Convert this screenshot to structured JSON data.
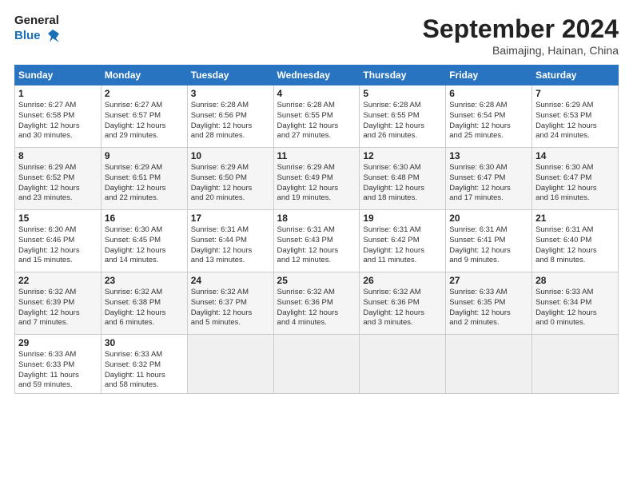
{
  "header": {
    "logo_line1": "General",
    "logo_line2": "Blue",
    "month": "September 2024",
    "location": "Baimajing, Hainan, China"
  },
  "days_of_week": [
    "Sunday",
    "Monday",
    "Tuesday",
    "Wednesday",
    "Thursday",
    "Friday",
    "Saturday"
  ],
  "weeks": [
    [
      {
        "day": "1",
        "info": "Sunrise: 6:27 AM\nSunset: 6:58 PM\nDaylight: 12 hours\nand 30 minutes."
      },
      {
        "day": "2",
        "info": "Sunrise: 6:27 AM\nSunset: 6:57 PM\nDaylight: 12 hours\nand 29 minutes."
      },
      {
        "day": "3",
        "info": "Sunrise: 6:28 AM\nSunset: 6:56 PM\nDaylight: 12 hours\nand 28 minutes."
      },
      {
        "day": "4",
        "info": "Sunrise: 6:28 AM\nSunset: 6:55 PM\nDaylight: 12 hours\nand 27 minutes."
      },
      {
        "day": "5",
        "info": "Sunrise: 6:28 AM\nSunset: 6:55 PM\nDaylight: 12 hours\nand 26 minutes."
      },
      {
        "day": "6",
        "info": "Sunrise: 6:28 AM\nSunset: 6:54 PM\nDaylight: 12 hours\nand 25 minutes."
      },
      {
        "day": "7",
        "info": "Sunrise: 6:29 AM\nSunset: 6:53 PM\nDaylight: 12 hours\nand 24 minutes."
      }
    ],
    [
      {
        "day": "8",
        "info": "Sunrise: 6:29 AM\nSunset: 6:52 PM\nDaylight: 12 hours\nand 23 minutes."
      },
      {
        "day": "9",
        "info": "Sunrise: 6:29 AM\nSunset: 6:51 PM\nDaylight: 12 hours\nand 22 minutes."
      },
      {
        "day": "10",
        "info": "Sunrise: 6:29 AM\nSunset: 6:50 PM\nDaylight: 12 hours\nand 20 minutes."
      },
      {
        "day": "11",
        "info": "Sunrise: 6:29 AM\nSunset: 6:49 PM\nDaylight: 12 hours\nand 19 minutes."
      },
      {
        "day": "12",
        "info": "Sunrise: 6:30 AM\nSunset: 6:48 PM\nDaylight: 12 hours\nand 18 minutes."
      },
      {
        "day": "13",
        "info": "Sunrise: 6:30 AM\nSunset: 6:47 PM\nDaylight: 12 hours\nand 17 minutes."
      },
      {
        "day": "14",
        "info": "Sunrise: 6:30 AM\nSunset: 6:47 PM\nDaylight: 12 hours\nand 16 minutes."
      }
    ],
    [
      {
        "day": "15",
        "info": "Sunrise: 6:30 AM\nSunset: 6:46 PM\nDaylight: 12 hours\nand 15 minutes."
      },
      {
        "day": "16",
        "info": "Sunrise: 6:30 AM\nSunset: 6:45 PM\nDaylight: 12 hours\nand 14 minutes."
      },
      {
        "day": "17",
        "info": "Sunrise: 6:31 AM\nSunset: 6:44 PM\nDaylight: 12 hours\nand 13 minutes."
      },
      {
        "day": "18",
        "info": "Sunrise: 6:31 AM\nSunset: 6:43 PM\nDaylight: 12 hours\nand 12 minutes."
      },
      {
        "day": "19",
        "info": "Sunrise: 6:31 AM\nSunset: 6:42 PM\nDaylight: 12 hours\nand 11 minutes."
      },
      {
        "day": "20",
        "info": "Sunrise: 6:31 AM\nSunset: 6:41 PM\nDaylight: 12 hours\nand 9 minutes."
      },
      {
        "day": "21",
        "info": "Sunrise: 6:31 AM\nSunset: 6:40 PM\nDaylight: 12 hours\nand 8 minutes."
      }
    ],
    [
      {
        "day": "22",
        "info": "Sunrise: 6:32 AM\nSunset: 6:39 PM\nDaylight: 12 hours\nand 7 minutes."
      },
      {
        "day": "23",
        "info": "Sunrise: 6:32 AM\nSunset: 6:38 PM\nDaylight: 12 hours\nand 6 minutes."
      },
      {
        "day": "24",
        "info": "Sunrise: 6:32 AM\nSunset: 6:37 PM\nDaylight: 12 hours\nand 5 minutes."
      },
      {
        "day": "25",
        "info": "Sunrise: 6:32 AM\nSunset: 6:36 PM\nDaylight: 12 hours\nand 4 minutes."
      },
      {
        "day": "26",
        "info": "Sunrise: 6:32 AM\nSunset: 6:36 PM\nDaylight: 12 hours\nand 3 minutes."
      },
      {
        "day": "27",
        "info": "Sunrise: 6:33 AM\nSunset: 6:35 PM\nDaylight: 12 hours\nand 2 minutes."
      },
      {
        "day": "28",
        "info": "Sunrise: 6:33 AM\nSunset: 6:34 PM\nDaylight: 12 hours\nand 0 minutes."
      }
    ],
    [
      {
        "day": "29",
        "info": "Sunrise: 6:33 AM\nSunset: 6:33 PM\nDaylight: 11 hours\nand 59 minutes."
      },
      {
        "day": "30",
        "info": "Sunrise: 6:33 AM\nSunset: 6:32 PM\nDaylight: 11 hours\nand 58 minutes."
      },
      {
        "day": "",
        "info": ""
      },
      {
        "day": "",
        "info": ""
      },
      {
        "day": "",
        "info": ""
      },
      {
        "day": "",
        "info": ""
      },
      {
        "day": "",
        "info": ""
      }
    ]
  ]
}
